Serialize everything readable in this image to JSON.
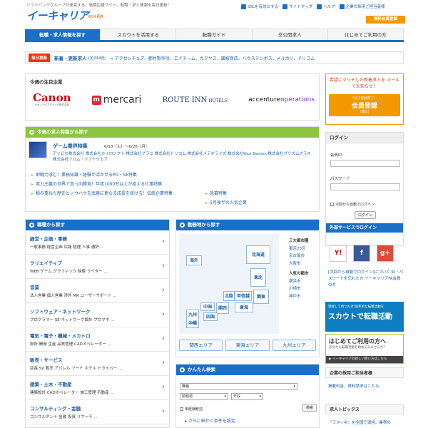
{
  "header": {
    "tagline": "ソフトバンクグループが運営する、転職応援サイト。転職・求人情報を毎日更新！",
    "logo": "イーキャリア",
    "update": "6/14更新",
    "links": [
      "SSLを有効にする",
      "サイトマップ",
      "ヘルプ",
      "企業の採用ご担当者様"
    ],
    "free_register": "無料会員登録"
  },
  "nav": [
    "転職・求人情報を探す",
    "スカウトを活用する",
    "転職ガイド",
    "非公開求人",
    "はじめてご利用の方"
  ],
  "new_jobs": {
    "badge": "毎日更新",
    "title": "新着・更新求人",
    "count": "(全244社)",
    "companies": "» アクセンチュア、郡村製作所、エイチーム、カクヤス、國桜商店、ハウステンボス、メルカリ、ドリコム"
  },
  "featured": {
    "heading": "今週の注目企業",
    "canon": "Canon",
    "canon_sub": "キヤノンビズアテンダ株式会社",
    "mercari": "mercari",
    "mercari_mark": "m",
    "route_a": "ROUTE INN",
    "route_b": " HOTELS",
    "accenture_a": "accenture",
    "accenture_b": "operations"
  },
  "promo": {
    "text": "希望にマッチした新着求人を メールでお知らせ！",
    "btn_small": "1分で登録完了！",
    "btn_big": "会員登録",
    "btn_suffix": "(無料)"
  },
  "tokushu": {
    "heading": "今週の求人特集から探す",
    "game_title": "ゲーム業界特集",
    "game_date": "6/13（火）〜6/26（月）",
    "game_cos": "アソビモ株式会社 株式会社カイロソフト 株式会社グラニ 株式会社ドリコム 株式会社メテオライズ 株式会社Your Games 株式会社ブリズムプラス 株式会社フロム・ソフトウェア",
    "links": [
      "即戦力求む！業務知識・経験が活かせるPG・SE特集",
      "実力主義の世界で真っ向勝負！年収1000万以上が狙える仕事特集",
      "積み重ねた歴史とノウハウを武器に更なる成長を続ける！伝統企業特集"
    ],
    "links2": [
      "急募特集",
      "5月後半の人気企業"
    ]
  },
  "login": {
    "heading": "ログイン",
    "id_label": "会員ID",
    "pw_label": "パスワード",
    "auto": "次回から自動でログイン",
    "btn": "ログイン",
    "external": "外部サービスでログイン",
    "note": "[次回から自動でログイン]について ID・パスワードを忘れた方 イーキャリアFA会員の方"
  },
  "social": [
    "Y!",
    "f",
    "g+"
  ],
  "banners": {
    "scout_small": "登録して待つだけ!効率的な転職活動を",
    "scout_big": "スカウトで転職活動",
    "guide_big": "はじめてご利用の方へ",
    "guide_small": "あなたも転職活動を始めてみませんか？",
    "guide_bottom": "▶ イーキャリアの詳しい使い方はこちら"
  },
  "side": {
    "corp_heading": "企業の採用ご担当者様",
    "corp_link": "掲載料金、資料請求はこちら",
    "topics_heading": "求人トピックス",
    "topics_text": "『ラフィネ』を全国で運営。業界の"
  },
  "shokushu": {
    "heading": "職種から探す",
    "cats": [
      {
        "n": "経営・企画・事務",
        "s": "一般事務 経営企画 広報 経理 人事 通訳 ..."
      },
      {
        "n": "クリエイティブ",
        "s": "WEB ゲーム グラフィック 映像 ライター ..."
      },
      {
        "n": "営業",
        "s": "法人営業 個人営業 渉外 MR ユーザーサポート ..."
      },
      {
        "n": "ソフトウェア・ネットワーク",
        "s": "プログラマー SE ネットワーク設計 プロマネ ..."
      },
      {
        "n": "電気・電子・機械・メカトロ",
        "s": "設計 開発 生産 品質管理 CADオペレーター ..."
      },
      {
        "n": "販売・サービス",
        "s": "店長 SV 販売 アパレル フード ホテル ドライバー ..."
      },
      {
        "n": "建築・土木・不動産",
        "s": "建築設計 CADオペレーター 施工管理 不動産 ..."
      },
      {
        "n": "コンサルティング・金融",
        "s": "コンサルタント 金融 投資 リサーチ ..."
      }
    ]
  },
  "area": {
    "heading": "勤務地から探す",
    "prefs": {
      "kaigai": "海外",
      "hokkaido": "北海道",
      "tohoku": "東北",
      "kanto": "関東",
      "koshinetsu": "甲信越",
      "hokuriku": "北陸",
      "tokai": "東海",
      "kansai": "関西",
      "chugoku": "中国",
      "shikoku": "四国",
      "kyushu": "九州 沖縄"
    },
    "list_h1": "三大都市圏",
    "list1": [
      "東京23区",
      "名古屋市",
      "大阪市"
    ],
    "list_h2": "人気の都市",
    "list2": [
      "横浜市",
      "川崎市",
      "神戸市"
    ],
    "btns": [
      "関西エリア",
      "東海エリア",
      "九州エリア"
    ]
  },
  "kantan": {
    "heading": "かんたん検索",
    "sel1": "職種",
    "sel2": "勤務地",
    "sel3": "年収",
    "inexp": "未経験歓迎",
    "search": "検索",
    "more": "▸ さらに細かく条件を設定"
  }
}
